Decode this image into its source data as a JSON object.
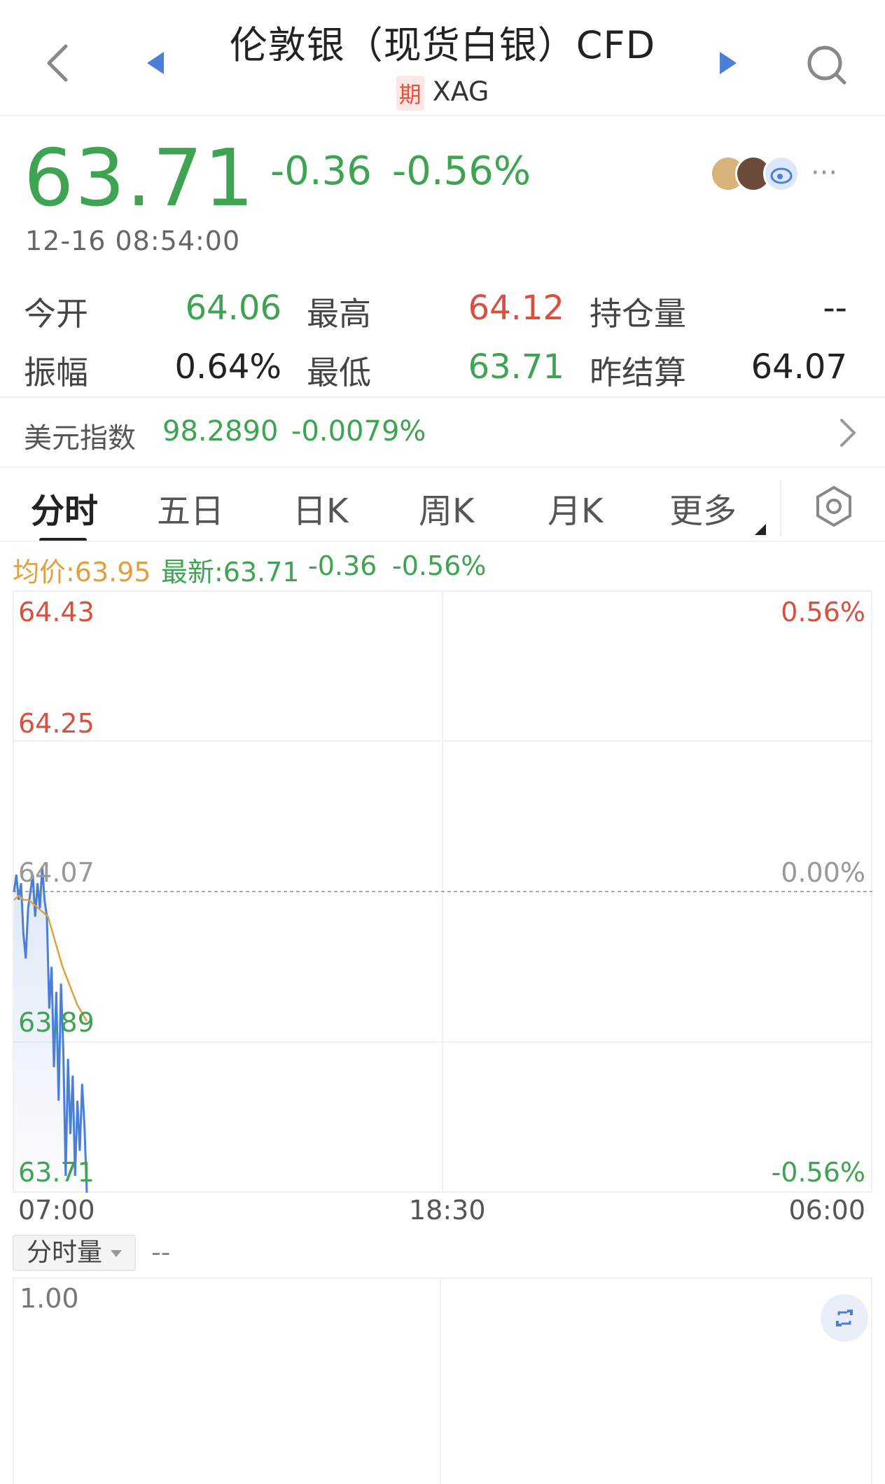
{
  "header": {
    "title": "伦敦银（现货白银）CFD",
    "badge": "期",
    "code": "XAG"
  },
  "quote": {
    "price": "63.71",
    "change": "-0.36",
    "change_pct": "-0.56%",
    "timestamp": "12-16 08:54:00",
    "more": "···"
  },
  "stats": {
    "open_label": "今开",
    "open_value": "64.06",
    "high_label": "最高",
    "high_value": "64.12",
    "oi_label": "持仓量",
    "oi_value": "--",
    "amp_label": "振幅",
    "amp_value": "0.64%",
    "low_label": "最低",
    "low_value": "63.71",
    "settle_label": "昨结算",
    "settle_value": "64.07"
  },
  "usd_index": {
    "label": "美元指数",
    "value": "98.2890",
    "change_pct": "-0.0079%"
  },
  "tabs": [
    "分时",
    "五日",
    "日K",
    "周K",
    "月K",
    "更多"
  ],
  "legend": {
    "avg": "均价:63.95",
    "latest": "最新:63.71",
    "change": "-0.36",
    "change_pct": "-0.56%"
  },
  "colors": {
    "up": "#d9503f",
    "down": "#3fa451",
    "price_line": "#4a7fd8",
    "avg_line": "#e0a040",
    "nav_arrow": "#4a7fd8"
  },
  "chart_data": {
    "type": "line",
    "y_left_ticks": [
      "64.43",
      "64.25",
      "64.07",
      "63.89",
      "63.71"
    ],
    "y_right_ticks": [
      "0.56%",
      "",
      "0.00%",
      "",
      "-0.56%"
    ],
    "x_ticks": [
      "07:00",
      "18:30",
      "06:00"
    ],
    "ylim": [
      63.71,
      64.43
    ],
    "reference_price": 64.07,
    "series": [
      {
        "values": [
          64.07,
          64.09,
          64.06,
          64.08,
          64.02,
          63.99,
          64.05,
          64.07,
          64.09,
          64.04,
          64.08,
          64.05,
          64.1,
          64.06,
          64.04,
          63.93,
          63.98,
          63.86,
          63.95,
          63.82,
          63.96,
          63.88,
          63.73,
          63.87,
          63.78,
          63.85,
          63.73,
          63.82,
          63.76,
          63.84,
          63.79,
          63.71
        ]
      },
      {
        "values": [
          64.06,
          64.065,
          64.06,
          64.06,
          64.055,
          64.05,
          64.045,
          64.04,
          64.02,
          64.0,
          63.98,
          63.965,
          63.95,
          63.935,
          63.925,
          63.915
        ]
      }
    ]
  },
  "volume": {
    "selector": "分时量",
    "value": "--",
    "axis_top": "1.00"
  }
}
